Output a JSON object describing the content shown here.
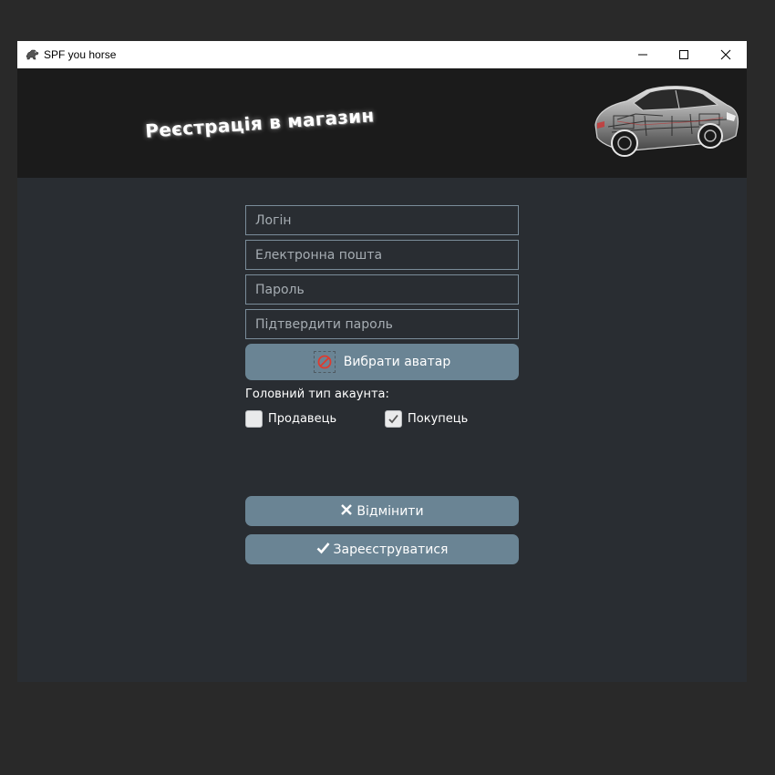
{
  "window": {
    "title": "SPF you horse",
    "icons": {
      "app": "horse-icon",
      "minimize": "minimize-icon",
      "maximize": "maximize-icon",
      "close": "close-icon"
    }
  },
  "banner": {
    "title": "Реєстрація в магазин",
    "image": "car-xray-image"
  },
  "form": {
    "login_placeholder": "Логін",
    "email_placeholder": "Електронна пошта",
    "password_placeholder": "Пароль",
    "confirm_password_placeholder": "Підтвердити пароль",
    "avatar_button": {
      "label": "Вибрати аватар",
      "icon": "no-image-icon"
    },
    "account_type": {
      "label": "Головний тип акаунта:",
      "seller": {
        "label": "Продавець",
        "checked": false
      },
      "buyer": {
        "label": "Покупець",
        "checked": true
      }
    },
    "cancel_button": {
      "label": "Відмінити",
      "icon": "cross-icon"
    },
    "register_button": {
      "label": "Зареєструватися",
      "icon": "checkmark-icon"
    }
  },
  "colors": {
    "page_background": "#292929",
    "window_background": "#292d32",
    "banner_background": "#1b1b1b",
    "button_background": "#6a8494",
    "field_border": "#7a8c99",
    "text": "#ffffff"
  }
}
